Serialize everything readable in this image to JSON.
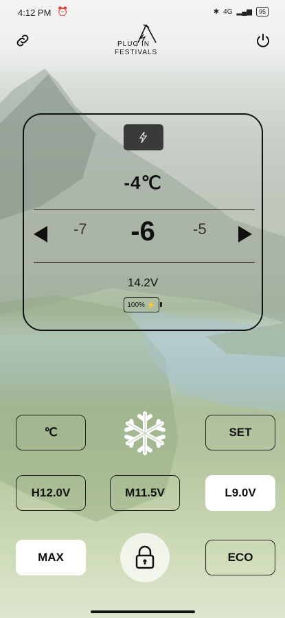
{
  "status_bar": {
    "time": "4:12 PM",
    "alarm_icon": "alarm-icon",
    "network": "4G",
    "battery": "95"
  },
  "header": {
    "link_icon": "link-icon",
    "logo_line1": "PLUG IN",
    "logo_line2": "FESTIVALS",
    "power_icon": "power-icon"
  },
  "panel": {
    "mode_icon": "plug-bolt-icon",
    "current_temp": "-4℃",
    "set_prev": "-7",
    "set_current": "-6",
    "set_next": "-5",
    "voltage": "14.2V",
    "battery_percent": "100%"
  },
  "controls": {
    "unit_label": "℃",
    "set_label": "SET",
    "h_label": "H12.0V",
    "m_label": "M11.5V",
    "l_label": "L9.0V",
    "max_label": "MAX",
    "eco_label": "ECO",
    "snow_icon": "snowflake-icon",
    "lock_icon": "lock-icon"
  },
  "colors": {
    "selected_button": "#ffffff",
    "panel_border": "#111111",
    "badge_bg": "#3a3a3a"
  }
}
